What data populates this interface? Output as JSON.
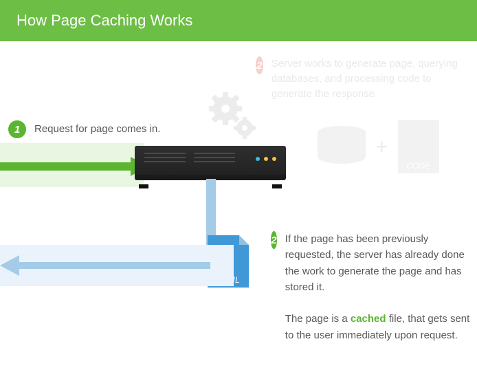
{
  "header": {
    "title": "How Page Caching Works"
  },
  "step1": {
    "num": "1",
    "text": "Request for page comes in."
  },
  "step2_faded": {
    "num": "2",
    "text": "Server works to generate page, querying databases, and processing code to generate the response."
  },
  "step2": {
    "num": "2",
    "text_a": "If the page has been previously requested, the server has already done the work to generate the page and has stored it.",
    "text_b_pre": "The page is a ",
    "cached_word": "cached",
    "text_b_post": " file, that gets sent to the user immediately upon request."
  },
  "labels": {
    "html": "HTML",
    "code": "CODE",
    "plus": "+"
  }
}
